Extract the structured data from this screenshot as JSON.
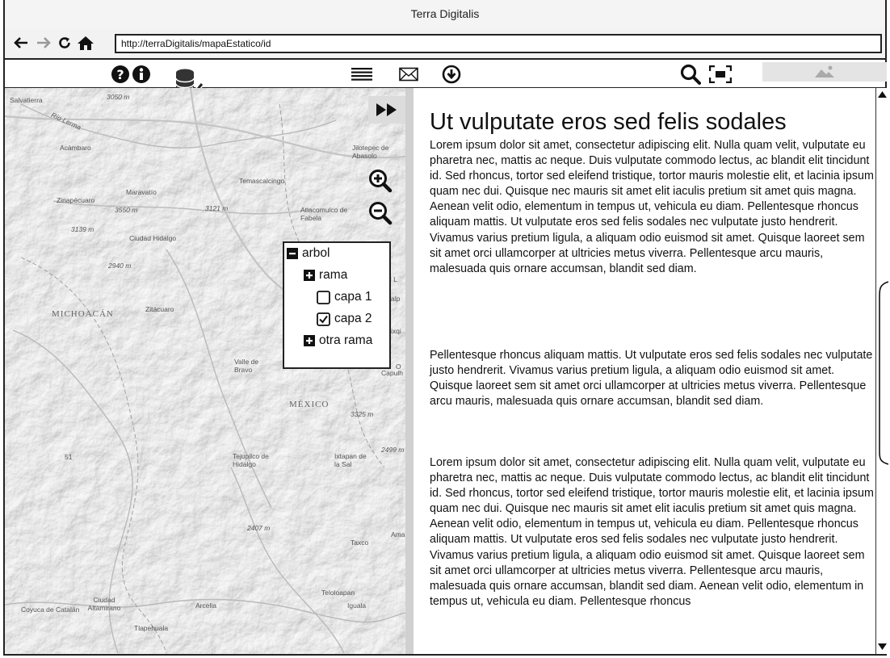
{
  "window": {
    "title": "Terra Digitalis"
  },
  "browser": {
    "url": "http://terraDigitalis/mapaEstatico/id"
  },
  "toolbar": {
    "icons": [
      "help-icon",
      "info-icon",
      "database-check-icon",
      "list-icon",
      "mail-icon",
      "download-icon",
      "search-icon",
      "fullscreen-icon",
      "image-placeholder-icon"
    ]
  },
  "map": {
    "place_labels": {
      "salvatierra": "Salvatierra",
      "elev_3050": "3050 m",
      "rio_lerma": "Río Lerma",
      "acambaro": "Acámbaro",
      "jilotepec": "Jilotepec de Abasolo",
      "temascalcingo": "Temascalcingo",
      "maravatio": "Maravatío",
      "zinapecuaro": "Zinapécuaro",
      "elev_3550": "3550 m",
      "elev_3121": "3121 m",
      "atlacomulco": "Atlacomulco de Fabela",
      "elev_3139": "3139 m",
      "ciudad_hidalgo": "Ciudad Hidalgo",
      "elev_2940": "2940 m",
      "michoacan": "MICHOACÁN",
      "zitacuaro": "Zitácuaro",
      "valle_de_bravo": "Valle de Bravo",
      "mexico": "MÉXICO",
      "elev_3325": "3325 m",
      "tejupilco": "Tejupilco de Hidalgo",
      "ixtapan": "Ixtapan de la Sal",
      "elev_2499": "2499 m",
      "elev_2407": "2407 m",
      "taxco": "Taxco",
      "teloloapan": "Teloloapan",
      "ciudad_altamirano": "Ciudad Altamirano",
      "coyuca": "Coyuca de Catalán",
      "arcelia": "Arcelia",
      "iguala": "Iguala",
      "tlapehuala": "Tlapehuala",
      "capulh": "Capulh",
      "cut_d": "d L",
      "cut_alp": "alp",
      "cut_ixqi": "ixqi",
      "cut_o": "O",
      "cut_ama": "Ama",
      "num_51": "51"
    },
    "layers": {
      "root": "arbol",
      "branch": "rama",
      "layer1": "capa 1",
      "layer2": "capa 2",
      "other_branch": "otra rama",
      "layer1_checked": false,
      "layer2_checked": true
    }
  },
  "article": {
    "heading": "Ut vulputate eros sed felis sodales",
    "paragraphs": [
      "Lorem ipsum dolor sit amet, consectetur adipiscing elit. Nulla quam velit, vulputate eu pharetra nec, mattis ac neque. Duis vulputate commodo lectus, ac blandit elit tincidunt id. Sed rhoncus, tortor sed eleifend tristique, tortor mauris molestie elit, et lacinia ipsum quam nec dui. Quisque nec mauris sit amet elit iaculis pretium sit amet quis magna. Aenean velit odio, elementum in tempus ut, vehicula eu diam. Pellentesque rhoncus aliquam mattis. Ut vulputate eros sed felis sodales nec vulputate justo hendrerit. Vivamus varius pretium ligula, a aliquam odio euismod sit amet. Quisque laoreet sem sit amet orci ullamcorper at ultricies metus viverra. Pellentesque arcu mauris, malesuada quis ornare accumsan, blandit sed diam.",
      "Pellentesque rhoncus aliquam mattis. Ut vulputate eros sed felis sodales nec vulputate justo hendrerit. Vivamus varius pretium ligula, a aliquam odio euismod sit amet. Quisque laoreet sem sit amet orci ullamcorper at ultricies metus viverra. Pellentesque arcu mauris, malesuada quis ornare accumsan, blandit sed diam.",
      "Lorem ipsum dolor sit amet, consectetur adipiscing elit. Nulla quam velit, vulputate eu pharetra nec, mattis ac neque. Duis vulputate commodo lectus, ac blandit elit tincidunt id. Sed rhoncus, tortor sed eleifend tristique, tortor mauris molestie elit, et lacinia ipsum quam nec dui. Quisque nec mauris sit amet elit iaculis pretium sit amet quis magna. Aenean velit odio, elementum in tempus ut, vehicula eu diam. Pellentesque rhoncus aliquam mattis. Ut vulputate eros sed felis sodales nec vulputate justo hendrerit. Vivamus varius pretium ligula, a aliquam odio euismod sit amet. Quisque laoreet sem sit amet orci ullamcorper at ultricies metus viverra. Pellentesque arcu mauris, malesuada quis ornare accumsan, blandit sed diam. Aenean velit odio, elementum in tempus ut, vehicula eu diam. Pellentesque rhoncus"
    ]
  }
}
